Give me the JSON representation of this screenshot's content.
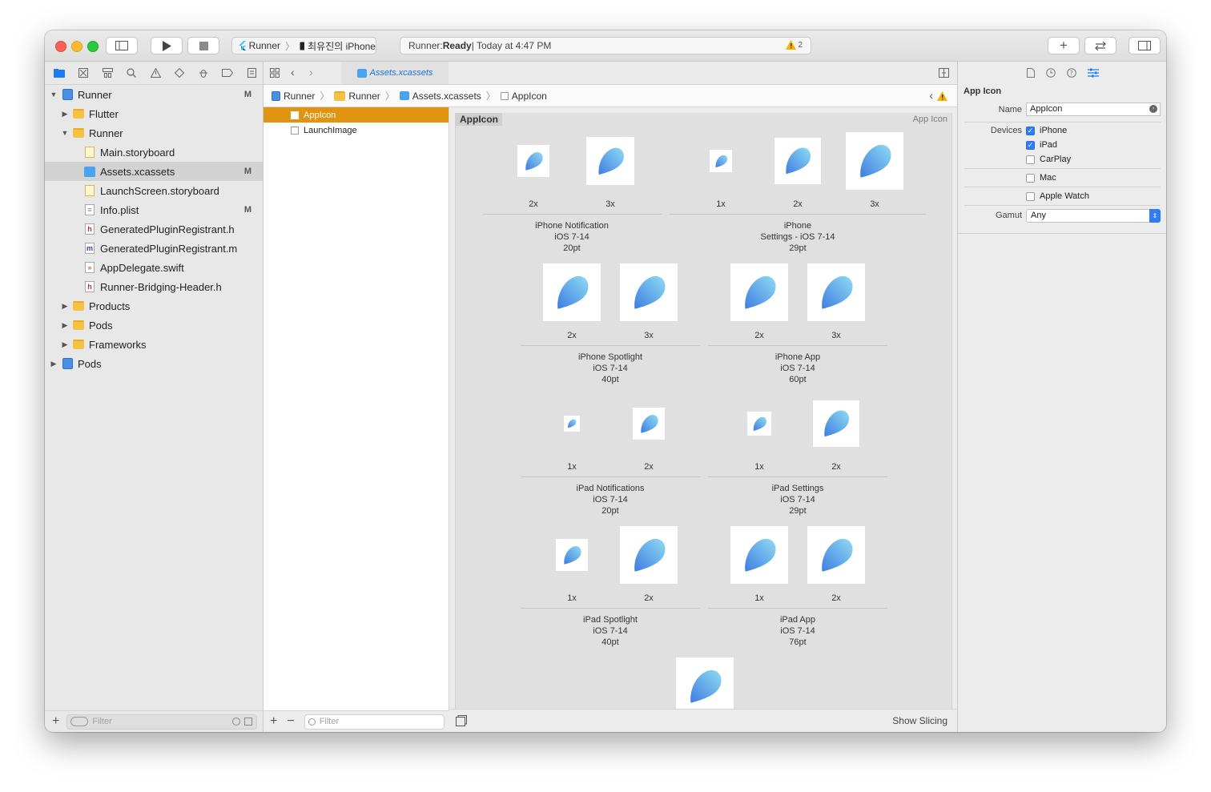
{
  "toolbar": {
    "scheme_target": "Runner",
    "scheme_device": "최유진의 iPhone",
    "activity_prefix": "Runner: ",
    "activity_status": "Ready",
    "activity_suffix": " | Today at 4:47 PM",
    "warning_count": "2"
  },
  "navigator": {
    "tree": [
      {
        "label": "Runner",
        "status": "M"
      },
      {
        "label": "Flutter",
        "status": ""
      },
      {
        "label": "Runner",
        "status": ""
      },
      {
        "label": "Main.storyboard",
        "status": ""
      },
      {
        "label": "Assets.xcassets",
        "status": "M"
      },
      {
        "label": "LaunchScreen.storyboard",
        "status": ""
      },
      {
        "label": "Info.plist",
        "status": "M"
      },
      {
        "label": "GeneratedPluginRegistrant.h",
        "status": ""
      },
      {
        "label": "GeneratedPluginRegistrant.m",
        "status": ""
      },
      {
        "label": "AppDelegate.swift",
        "status": ""
      },
      {
        "label": "Runner-Bridging-Header.h",
        "status": ""
      },
      {
        "label": "Products",
        "status": ""
      },
      {
        "label": "Pods",
        "status": ""
      },
      {
        "label": "Frameworks",
        "status": ""
      },
      {
        "label": "Pods",
        "status": ""
      }
    ],
    "filter_placeholder": "Filter"
  },
  "editor": {
    "tab_label": "Assets.xcassets",
    "breadcrumb": [
      "Runner",
      "Runner",
      "Assets.xcassets",
      "AppIcon"
    ],
    "assets": [
      "AppIcon",
      "LaunchImage"
    ],
    "asset_filter_placeholder": "Filter",
    "set_title": "AppIcon",
    "set_type": "App Icon",
    "show_slicing": "Show Slicing",
    "groups": [
      {
        "line1": "iPhone Notification",
        "line2": "iOS 7-14",
        "line3": "20pt",
        "scales": [
          "2x",
          "3x"
        ]
      },
      {
        "line1": "iPhone",
        "line2": "Settings - iOS 7-14",
        "line3": "29pt",
        "scales": [
          "1x",
          "2x",
          "3x"
        ]
      },
      {
        "line1": "iPhone Spotlight",
        "line2": "iOS 7-14",
        "line3": "40pt",
        "scales": [
          "2x",
          "3x"
        ]
      },
      {
        "line1": "iPhone App",
        "line2": "iOS 7-14",
        "line3": "60pt",
        "scales": [
          "2x",
          "3x"
        ]
      },
      {
        "line1": "iPad Notifications",
        "line2": "iOS 7-14",
        "line3": "20pt",
        "scales": [
          "1x",
          "2x"
        ]
      },
      {
        "line1": "iPad Settings",
        "line2": "iOS 7-14",
        "line3": "29pt",
        "scales": [
          "1x",
          "2x"
        ]
      },
      {
        "line1": "iPad Spotlight",
        "line2": "iOS 7-14",
        "line3": "40pt",
        "scales": [
          "1x",
          "2x"
        ]
      },
      {
        "line1": "iPad App",
        "line2": "iOS 7-14",
        "line3": "76pt",
        "scales": [
          "1x",
          "2x"
        ]
      }
    ]
  },
  "inspector": {
    "title": "App Icon",
    "name_label": "Name",
    "name_value": "AppIcon",
    "devices_label": "Devices",
    "devices": [
      {
        "label": "iPhone",
        "checked": true
      },
      {
        "label": "iPad",
        "checked": true
      },
      {
        "label": "CarPlay",
        "checked": false
      },
      {
        "label": "Mac",
        "checked": false
      },
      {
        "label": "Apple Watch",
        "checked": false
      }
    ],
    "gamut_label": "Gamut",
    "gamut_value": "Any"
  },
  "colors": {
    "selection_orange": "#e19312",
    "accent_blue": "#2f7cf6",
    "folder_yellow": "#f6c243"
  }
}
